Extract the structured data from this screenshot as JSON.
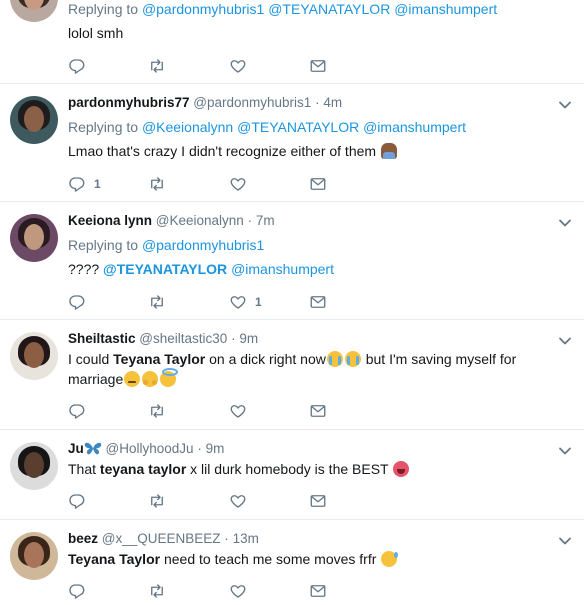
{
  "tweets": [
    {
      "reply": {
        "prefix": "Replying to",
        "mentions": [
          "@pardonmyhubris1",
          "@TEYANATAYLOR",
          "@imanshumpert"
        ]
      },
      "text": "lolol smh",
      "counts": {
        "reply": "",
        "retweet": "",
        "like": ""
      }
    },
    {
      "name": "pardonmyhubris77",
      "handle": "@pardonmyhubris1",
      "dot": "·",
      "time": "4m",
      "reply": {
        "prefix": "Replying to",
        "mentions": [
          "@Keeionalynn",
          "@TEYANATAYLOR",
          "@imanshumpert"
        ]
      },
      "text": "Lmao that's crazy I didn't recognize either of them",
      "counts": {
        "reply": "1",
        "retweet": "",
        "like": ""
      }
    },
    {
      "name": "Keeiona lynn",
      "handle": "@Keeionalynn",
      "dot": "·",
      "time": "7m",
      "reply": {
        "prefix": "Replying to",
        "mentions": [
          "@pardonmyhubris1"
        ]
      },
      "text_parts": {
        "a": "???? ",
        "b": "@TEYANATAYLOR",
        "c": " ",
        "d": "@imanshumpert"
      },
      "counts": {
        "reply": "",
        "retweet": "",
        "like": "1"
      }
    },
    {
      "name": "Sheiltastic",
      "handle": "@sheiltastic30",
      "dot": "·",
      "time": "9m",
      "text_parts": {
        "a": "I could ",
        "b": "Teyana Taylor",
        "c": " on a dick right now",
        "d": " but I'm saving myself for",
        "e": "marriage"
      },
      "counts": {
        "reply": "",
        "retweet": "",
        "like": ""
      }
    },
    {
      "name": "Ju",
      "handle": "@HollyhoodJu",
      "dot": "·",
      "time": "9m",
      "text_parts": {
        "a": "That ",
        "b": "teyana taylor",
        "c": " x lil durk homebody is the BEST"
      },
      "counts": {
        "reply": "",
        "retweet": "",
        "like": ""
      }
    },
    {
      "name": "beez",
      "handle": "@x__QUEENBEEZ",
      "dot": "·",
      "time": "13m",
      "text_parts": {
        "a": "Teyana Taylor",
        "b": " need to teach me some moves frfr"
      },
      "counts": {
        "reply": "",
        "retweet": "",
        "like": ""
      }
    }
  ],
  "colors": {
    "link": "#1b95e0",
    "muted": "#657786",
    "text": "#14171a",
    "divider": "#e6ecf0"
  },
  "icons": {
    "reply": "reply-icon",
    "retweet": "retweet-icon",
    "like": "heart-icon",
    "dm": "envelope-icon",
    "more": "chevron-down-icon"
  }
}
